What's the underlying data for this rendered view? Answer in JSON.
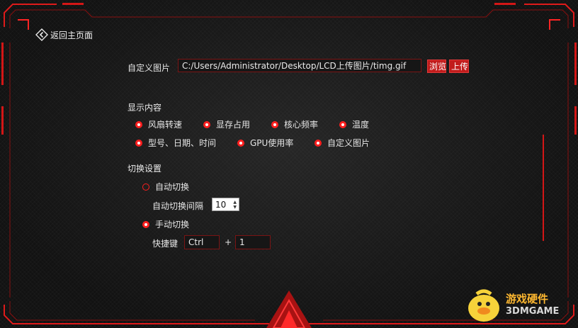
{
  "nav": {
    "back_label": "返回主页面"
  },
  "image": {
    "label": "自定义图片",
    "path": "C:/Users/Administrator/Desktop/LCD上传图片/timg.gif",
    "browse_label": "浏览",
    "upload_label": "上传"
  },
  "display": {
    "title": "显示内容",
    "options": [
      "风扇转速",
      "显存占用",
      "核心频率",
      "温度",
      "型号、日期、时间",
      "GPU使用率",
      "自定义图片"
    ]
  },
  "switch": {
    "title": "切换设置",
    "auto_label": "自动切换",
    "auto_selected": false,
    "interval_label": "自动切换间隔",
    "interval_value": "10",
    "manual_label": "手动切换",
    "manual_selected": true,
    "hotkey_label": "快捷键",
    "hotkey_modifier": "Ctrl",
    "plus": "+",
    "hotkey_key": "1"
  },
  "watermark": {
    "line1": "游戏硬件",
    "line2": "3DMGAME"
  },
  "colors": {
    "accent": "#ff1f1f",
    "background": "#141414",
    "text": "#e6e6e6"
  }
}
